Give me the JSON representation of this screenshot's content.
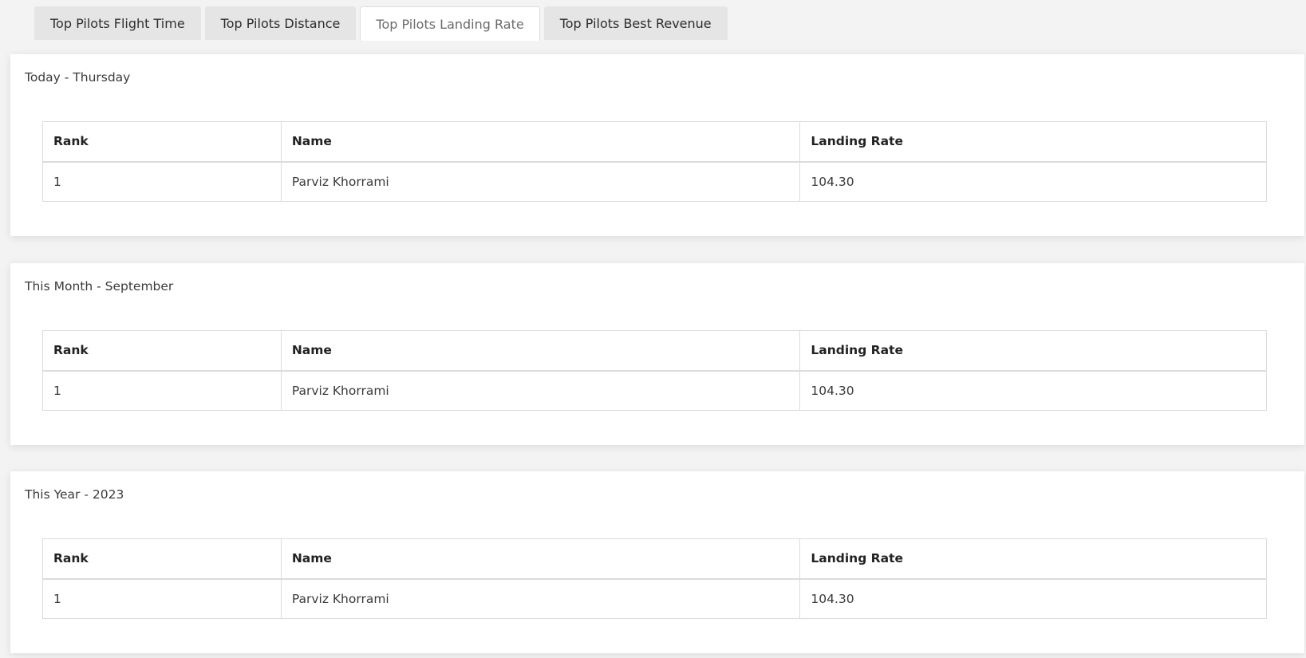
{
  "tabs": [
    {
      "label": "Top Pilots Flight Time",
      "active": false
    },
    {
      "label": "Top Pilots Distance",
      "active": false
    },
    {
      "label": "Top Pilots Landing Rate",
      "active": true
    },
    {
      "label": "Top Pilots Best Revenue",
      "active": false
    }
  ],
  "panels": [
    {
      "title": "Today - Thursday",
      "columns": [
        "Rank",
        "Name",
        "Landing Rate"
      ],
      "rows": [
        {
          "rank": "1",
          "name": "Parviz Khorrami",
          "landing_rate": "104.30"
        }
      ]
    },
    {
      "title": "This Month - September",
      "columns": [
        "Rank",
        "Name",
        "Landing Rate"
      ],
      "rows": [
        {
          "rank": "1",
          "name": "Parviz Khorrami",
          "landing_rate": "104.30"
        }
      ]
    },
    {
      "title": "This Year - 2023",
      "columns": [
        "Rank",
        "Name",
        "Landing Rate"
      ],
      "rows": [
        {
          "rank": "1",
          "name": "Parviz Khorrami",
          "landing_rate": "104.30"
        }
      ]
    }
  ]
}
